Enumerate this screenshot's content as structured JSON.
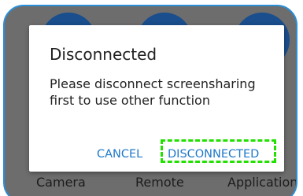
{
  "background": {
    "labels": [
      "Camera",
      "Remote",
      "Application"
    ]
  },
  "dialog": {
    "title": "Disconnected",
    "message": "Please disconnect screensharing first to use other function",
    "cancel_label": "CANCEL",
    "confirm_label": "DISCONNECTED"
  },
  "colors": {
    "accent": "#1f78c8",
    "panel_border": "#2a8ed8",
    "focus_highlight": "#22e000",
    "overlay": "#6d6d6d"
  }
}
